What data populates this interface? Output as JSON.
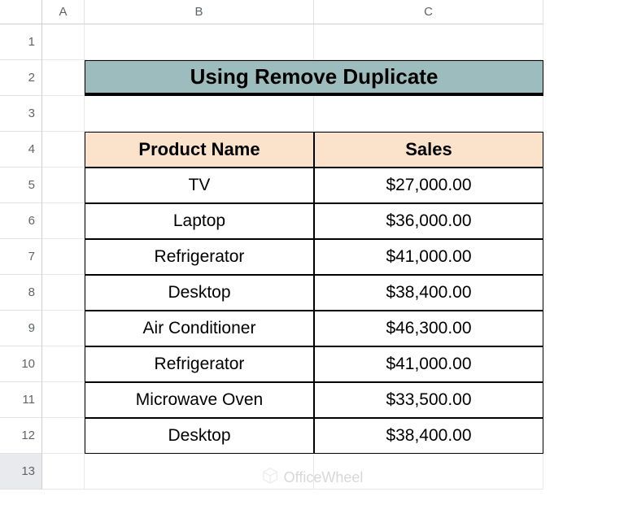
{
  "columns": [
    "A",
    "B",
    "C"
  ],
  "rows": [
    "1",
    "2",
    "3",
    "4",
    "5",
    "6",
    "7",
    "8",
    "9",
    "10",
    "11",
    "12",
    "13"
  ],
  "title": "Using Remove Duplicate",
  "headers": {
    "product": "Product Name",
    "sales": "Sales"
  },
  "data": [
    {
      "product": "TV",
      "sales": "$27,000.00"
    },
    {
      "product": "Laptop",
      "sales": "$36,000.00"
    },
    {
      "product": "Refrigerator",
      "sales": "$41,000.00"
    },
    {
      "product": "Desktop",
      "sales": "$38,400.00"
    },
    {
      "product": "Air Conditioner",
      "sales": "$46,300.00"
    },
    {
      "product": "Refrigerator",
      "sales": "$41,000.00"
    },
    {
      "product": "Microwave Oven",
      "sales": "$33,500.00"
    },
    {
      "product": "Desktop",
      "sales": "$38,400.00"
    }
  ],
  "watermark": "OfficeWheel",
  "chart_data": {
    "type": "table",
    "title": "Using Remove Duplicate",
    "columns": [
      "Product Name",
      "Sales"
    ],
    "rows": [
      [
        "TV",
        27000.0
      ],
      [
        "Laptop",
        36000.0
      ],
      [
        "Refrigerator",
        41000.0
      ],
      [
        "Desktop",
        38400.0
      ],
      [
        "Air Conditioner",
        46300.0
      ],
      [
        "Refrigerator",
        41000.0
      ],
      [
        "Microwave Oven",
        33500.0
      ],
      [
        "Desktop",
        38400.0
      ]
    ]
  }
}
